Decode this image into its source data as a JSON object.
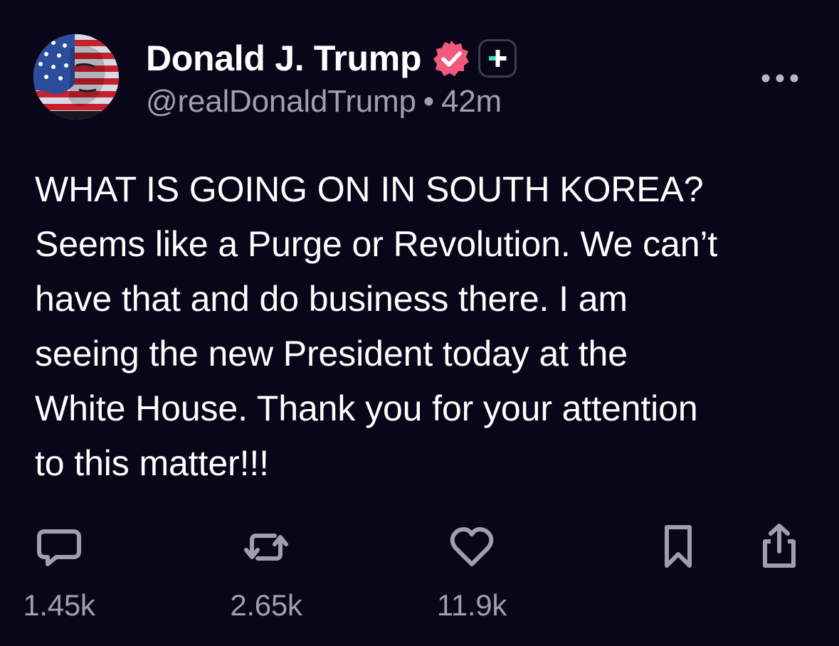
{
  "post": {
    "author": {
      "display_name": "Donald J. Trump",
      "handle": "@realDonaldTrump",
      "time_ago": "42m",
      "separator": "•"
    },
    "content": "WHAT IS GOING ON IN SOUTH KOREA?\nSeems like a Purge or Revolution. We can’t\nhave that and do business there. I am\nseeing the new President today at the\nWhite House. Thank you for your attention\nto this matter!!!",
    "actions": {
      "reply_count": "1.45k",
      "repost_count": "2.65k",
      "like_count": "11.9k"
    }
  },
  "icons": {
    "verified": "verified-badge-icon",
    "plus": "plus-badge-icon",
    "more": "more-dots-icon",
    "reply": "reply-bubble-icon",
    "repost": "repost-arrows-icon",
    "like": "heart-icon",
    "bookmark": "bookmark-icon",
    "share": "share-icon"
  },
  "colors": {
    "background": "#0a0619",
    "text": "#ffffff",
    "secondary_text": "#a09fae",
    "verified_badge": "#f2597b",
    "plus_accent": "#3de0c0"
  }
}
